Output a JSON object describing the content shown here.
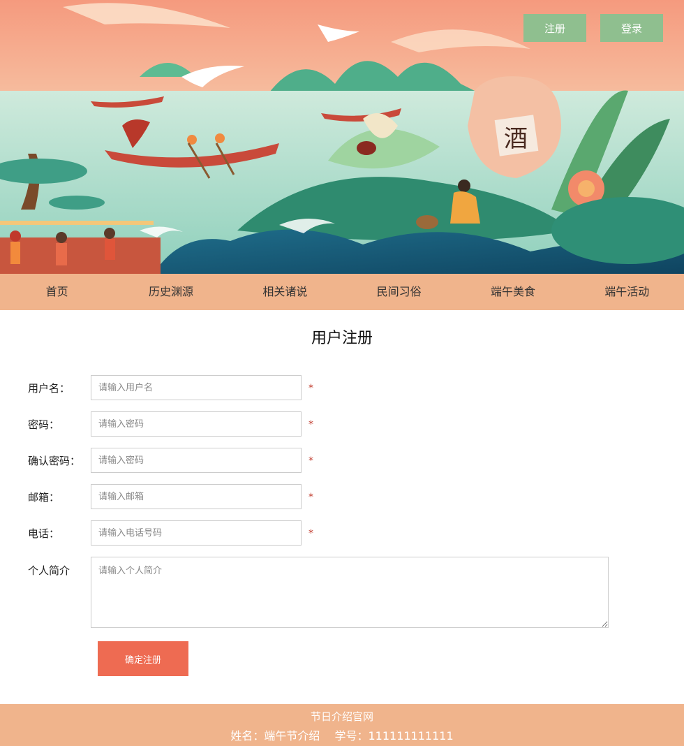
{
  "header": {
    "register_label": "注册",
    "login_label": "登录"
  },
  "banner": {
    "wine_char": "酒"
  },
  "nav": {
    "items": [
      "首页",
      "历史渊源",
      "相关诸说",
      "民间习俗",
      "端午美食",
      "端午活动"
    ]
  },
  "form": {
    "title": "用户注册",
    "fields": [
      {
        "label": "用户名：",
        "placeholder": "请输入用户名",
        "required_mark": "*"
      },
      {
        "label": "密码：",
        "placeholder": "请输入密码",
        "required_mark": "*"
      },
      {
        "label": "确认密码：",
        "placeholder": "请输入密码",
        "required_mark": "*"
      },
      {
        "label": "邮箱：",
        "placeholder": "请输入邮箱",
        "required_mark": "*"
      },
      {
        "label": "电话：",
        "placeholder": "请输入电话号码",
        "required_mark": "*"
      }
    ],
    "bio": {
      "label": "个人简介",
      "placeholder": "请输入个人简介"
    },
    "submit_label": "确定注册"
  },
  "footer": {
    "site_name": "节日介绍官网",
    "name_text": "姓名：端午节介绍",
    "student_id_text": "学号：111111111111"
  },
  "colors": {
    "nav_bg": "#f0b48c",
    "auth_button": "#8fbf8f",
    "submit_button": "#ee6b52",
    "required": "#c0392b"
  }
}
